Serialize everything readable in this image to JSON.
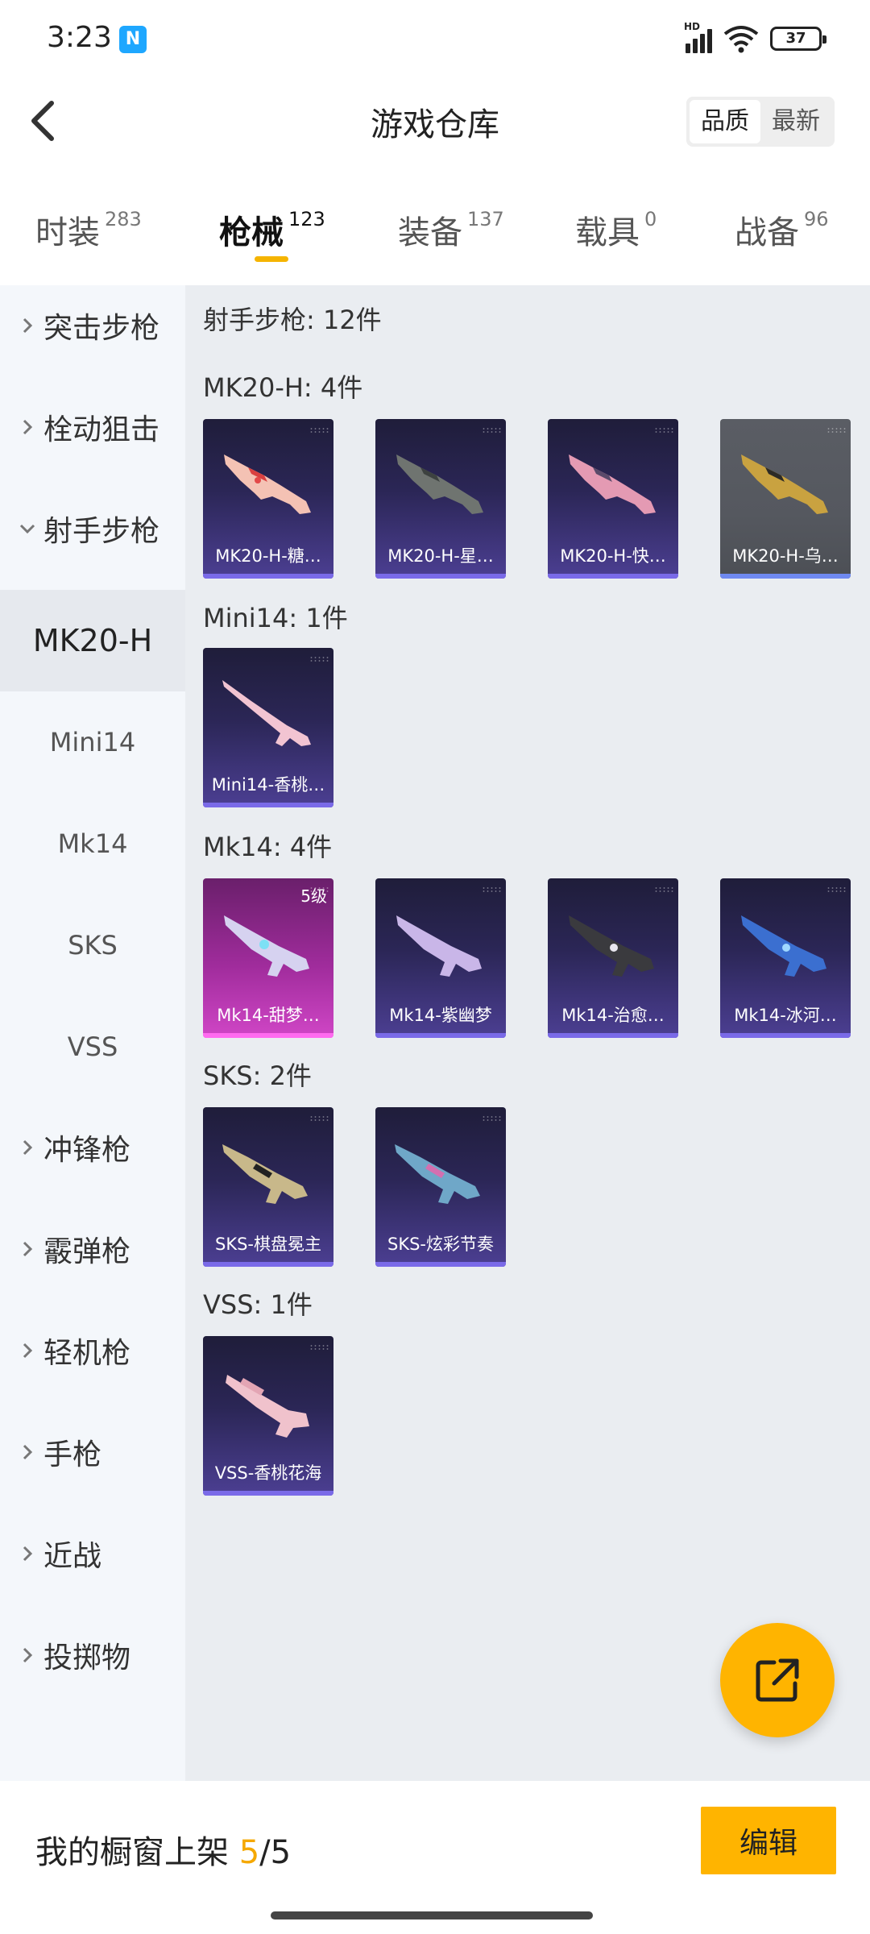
{
  "status_bar": {
    "time": "3:23",
    "nfc": "N",
    "hd": "HD",
    "battery": "37"
  },
  "header": {
    "title": "游戏仓库",
    "sort_options": [
      "品质",
      "最新"
    ],
    "sort_active": 0
  },
  "tabs": [
    {
      "label": "时装",
      "count": "283"
    },
    {
      "label": "枪械",
      "count": "123"
    },
    {
      "label": "装备",
      "count": "137"
    },
    {
      "label": "载具",
      "count": "0"
    },
    {
      "label": "战备",
      "count": "96"
    }
  ],
  "active_tab": 1,
  "sidebar": {
    "top_categories": [
      "突击步枪",
      "栓动狙击",
      "射手步枪"
    ],
    "sub_items": [
      "MK20-H",
      "Mini14",
      "Mk14",
      "SKS",
      "VSS"
    ],
    "active_sub": 0,
    "bottom_categories": [
      "冲锋枪",
      "霰弹枪",
      "轻机枪",
      "手枪",
      "近战",
      "投掷物"
    ]
  },
  "content": {
    "summary": "射手步枪: 12件",
    "groups": [
      {
        "title": "MK20-H: 4件",
        "items": [
          "MK20-H-糖…",
          "MK20-H-星…",
          "MK20-H-快…",
          "MK20-H-乌…"
        ]
      },
      {
        "title": "Mini14: 1件",
        "items": [
          "Mini14-香桃…"
        ]
      },
      {
        "title": "Mk14: 4件",
        "items": [
          "Mk14-甜梦…",
          "Mk14-紫幽梦",
          "Mk14-治愈…",
          "Mk14-冰河…"
        ],
        "level_badge": "5级"
      },
      {
        "title": "SKS: 2件",
        "items": [
          "SKS-棋盘冕主",
          "SKS-炫彩节奏"
        ]
      },
      {
        "title": "VSS: 1件",
        "items": [
          "VSS-香桃花海"
        ]
      }
    ]
  },
  "bottom": {
    "shelf_label": "我的橱窗上架",
    "shelf_used": "5",
    "shelf_sep": "/",
    "shelf_total": "5",
    "edit_label": "编辑"
  },
  "colors": {
    "accent": "#ffb400",
    "tab_indicator": "#f5b400",
    "card_purple": "#4c3f93",
    "card_pink": "#d046c6"
  },
  "icons": {
    "back": "chevron-left-icon",
    "share": "share-external-icon",
    "expand": "chevron-right-icon",
    "collapse": "chevron-down-icon"
  }
}
